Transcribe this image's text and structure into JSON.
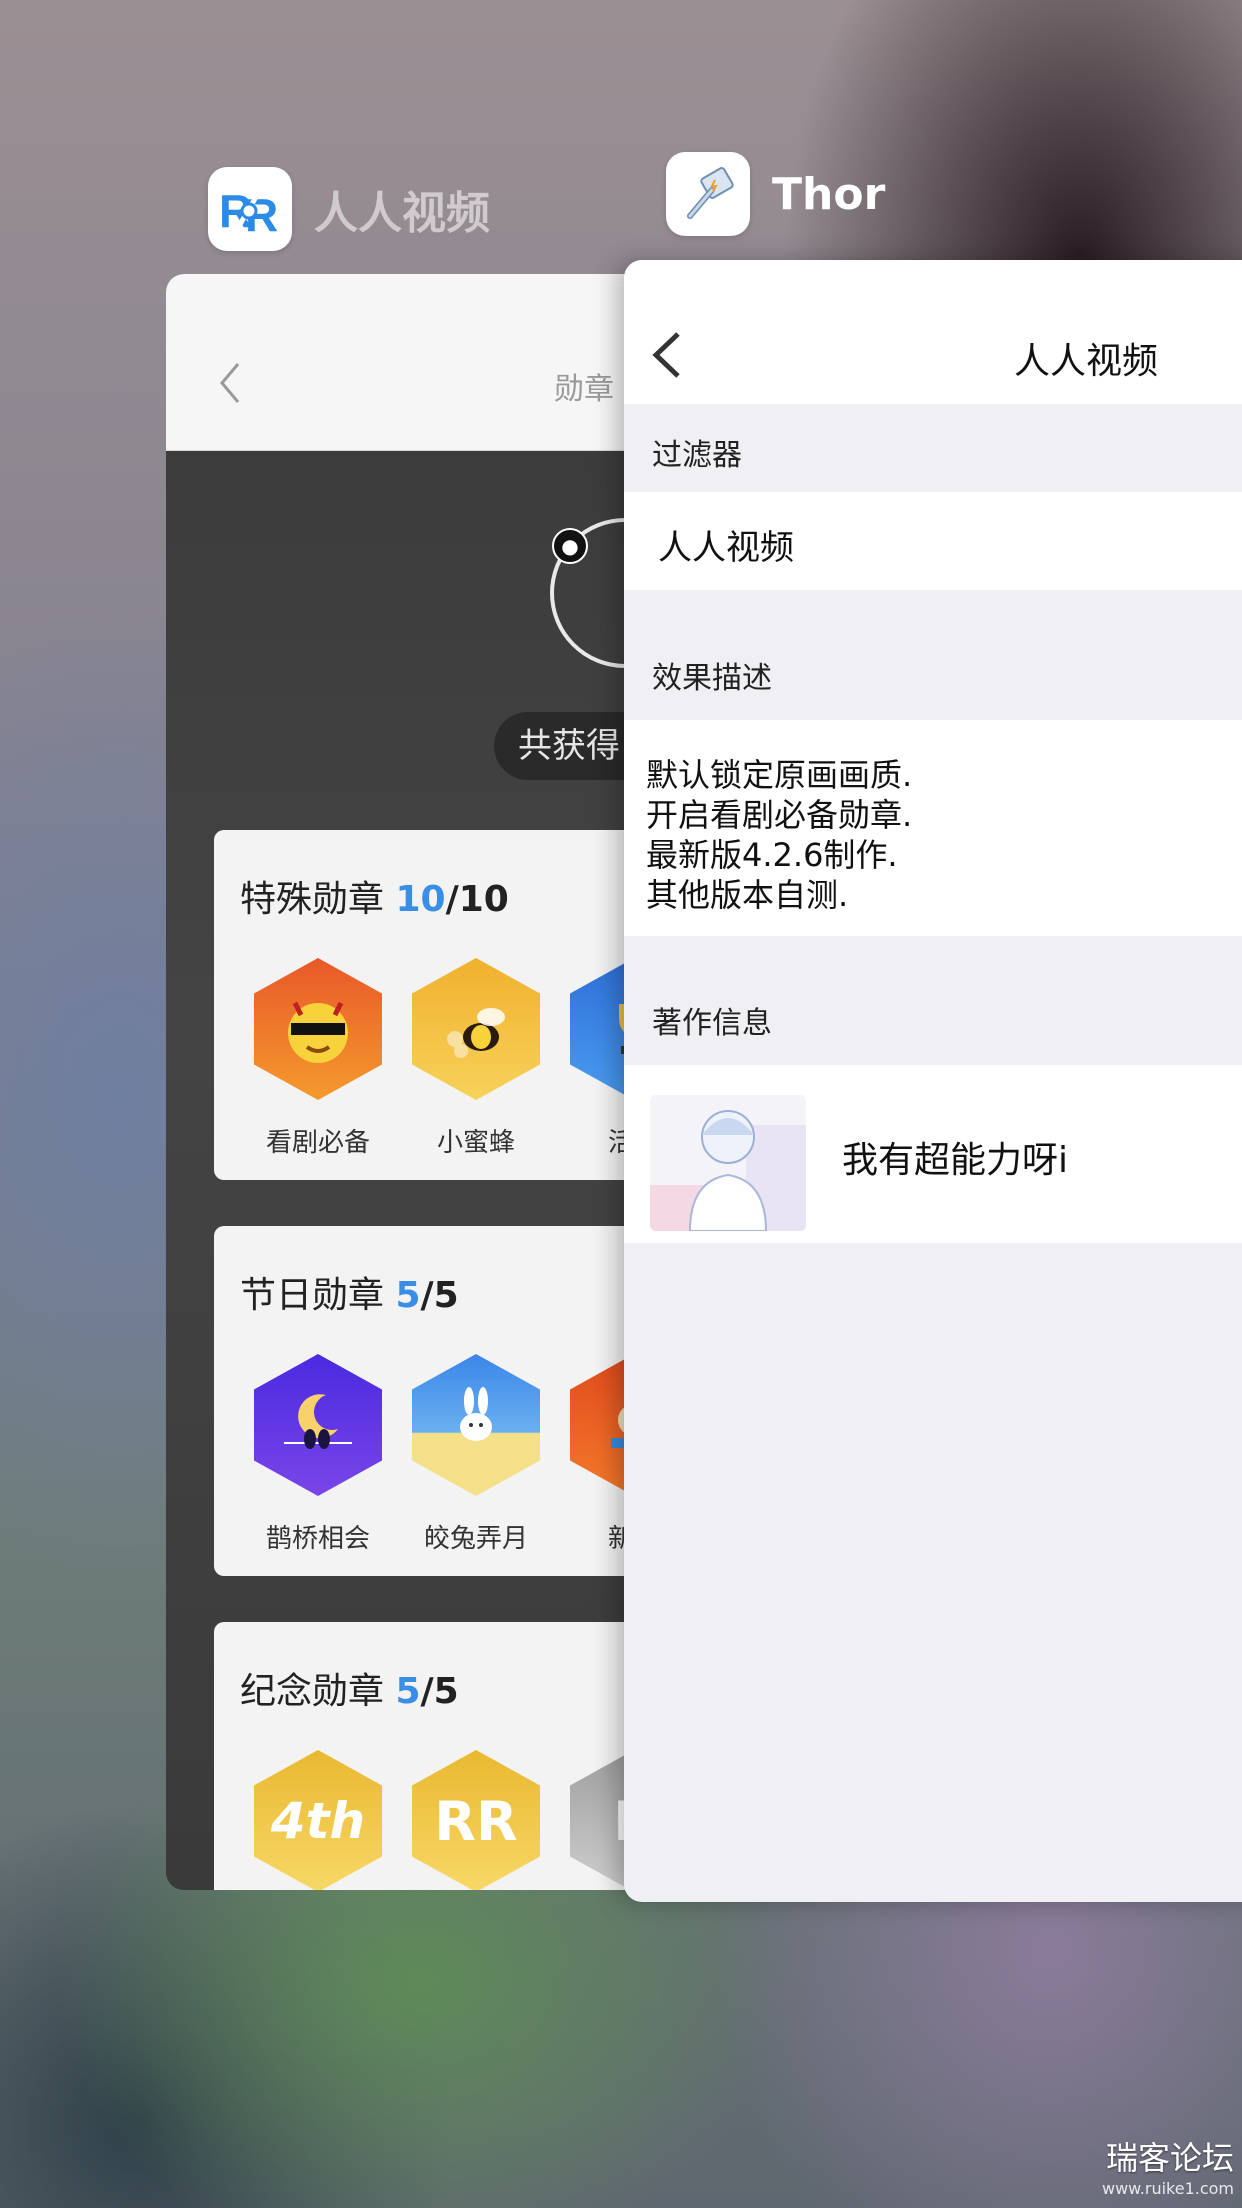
{
  "switcher": {
    "rr_app": {
      "name": "人人视频",
      "icon": "rr-logo-icon"
    },
    "thor_app": {
      "name": "Thor",
      "icon": "hammer-icon"
    }
  },
  "rr_card": {
    "nav_title": "勋章",
    "total_pill": "共获得",
    "sections": [
      {
        "title": "特殊勋章",
        "count": "10",
        "total": "/10",
        "medals": [
          {
            "label": "看剧必备",
            "color": "#ef6a2a",
            "icon": "sunglasses-devil-icon"
          },
          {
            "label": "小蜜蜂",
            "color": "#f2b62f",
            "icon": "bee-icon"
          },
          {
            "label": "活跃",
            "color": "#3a7ee8",
            "icon": "trophy-icon"
          }
        ]
      },
      {
        "title": "节日勋章",
        "count": "5",
        "total": "/5",
        "medals": [
          {
            "label": "鹊桥相会",
            "color": "#5b33e0",
            "icon": "moon-birds-icon"
          },
          {
            "label": "皎兔弄月",
            "color": "#4a93e8",
            "icon": "rabbit-icon"
          },
          {
            "label": "新年",
            "color": "#e85b24",
            "icon": "lion-dance-icon"
          }
        ]
      },
      {
        "title": "纪念勋章",
        "count": "5",
        "total": "/5",
        "medals": [
          {
            "label": "4th",
            "color": "#f0c64a",
            "icon": "4th-anniversary-icon"
          },
          {
            "label": "",
            "color": "#f0c64a",
            "icon": "rr-logo-icon"
          },
          {
            "label": "",
            "color": "#b8b8b8",
            "icon": "rr-logo-gray-icon"
          }
        ]
      }
    ]
  },
  "thor_card": {
    "nav_title": "人人视频",
    "filter_header": "过滤器",
    "filter_value": "人人视频",
    "desc_header": "效果描述",
    "desc_lines": [
      "默认锁定原画画质.",
      "开启看剧必备勋章.",
      "最新版4.2.6制作.",
      "其他版本自测."
    ],
    "author_header": "著作信息",
    "author_name": "我有超能力呀i"
  },
  "watermark": {
    "main": "瑞客论坛",
    "sub": "www.ruike1.com"
  }
}
